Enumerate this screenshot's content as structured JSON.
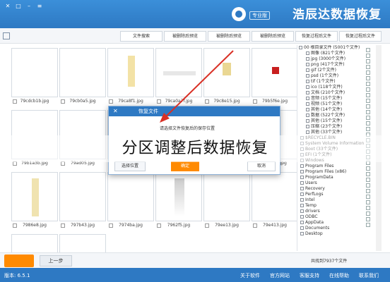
{
  "app": {
    "brand_title": "浩辰达数据恢复",
    "brand_badge": "专业版"
  },
  "toolbar": {
    "buttons": [
      "恢复过程后文件",
      "恢复过程后文件",
      "被删除后预览",
      "被删除后预览",
      "被删除后预览",
      "文件搜索"
    ]
  },
  "files": [
    {
      "name": "79cdcb1b.jpg"
    },
    {
      "name": "79cb0a5.jpg"
    },
    {
      "name": "79ca8f1.jpg"
    },
    {
      "name": "79ca0a7f.jpg"
    },
    {
      "name": "79c8e15.jpg"
    },
    {
      "name": "79b5f6e.jpg"
    },
    {
      "name": "79b1a3b.jpg"
    },
    {
      "name": "79ad05.jpg"
    },
    {
      "name": "79a7d2.jpg"
    },
    {
      "name": "79a1e0f.jpg"
    },
    {
      "name": "7998f4.jpg"
    },
    {
      "name": "7991c3.jpg"
    },
    {
      "name": "7986e8.jpg"
    },
    {
      "name": "797b43.jpg"
    },
    {
      "name": "7974ba.jpg"
    },
    {
      "name": "7962f5.jpg"
    },
    {
      "name": "79ee13.jpg"
    },
    {
      "name": "79e413.jpg"
    },
    {
      "name": "7984b9.jpg"
    },
    {
      "name": "794136.jpg"
    }
  ],
  "tree": {
    "rows": [
      "00 根目录文件 (5001个文件)",
      "图像 (821个文件)",
      "jpg (3000个文件)",
      "png (417个文件)",
      "gif (2个文件)",
      "psd (1个文件)",
      "tif (1个文件)",
      "ico (118个文件)",
      "文档 (210个文件)",
      "音频 (15个文件)",
      "视频 (51个文件)",
      "其他 (14个文件)",
      "数据 (522个文件)",
      "其他 (15个文件)",
      "压缩 (23个文件)",
      "其他 (33个文件)",
      "$RECYCLE.BIN",
      "System Volume Information",
      "Boot (33个文件)",
      "EFI (1个文件)",
      "Windows",
      "Program Files",
      "Program Files (x86)",
      "ProgramData",
      "Users",
      "Recovery",
      "PerfLogs",
      "Intel",
      "Temp",
      "drivers",
      "ODBC",
      "AppData",
      "Documents",
      "Desktop"
    ]
  },
  "dialog": {
    "title": "恢复文件",
    "message": "请选择文件恢复后的保存位置",
    "save_path_btn": "选择位置",
    "ok_btn": "确定",
    "cancel_btn": "取消"
  },
  "caption": "分区调整后数据恢复",
  "footer": {
    "back_label": "上一步",
    "summary": "共找到7937个文件"
  },
  "status": {
    "version": "版本: 6.5.1",
    "links": [
      "关于软件",
      "官方网站",
      "客服支持",
      "在线帮助",
      "联系我们"
    ]
  },
  "colors": {
    "brand_blue": "#2e79c3",
    "accent_orange": "#ff8a00"
  }
}
